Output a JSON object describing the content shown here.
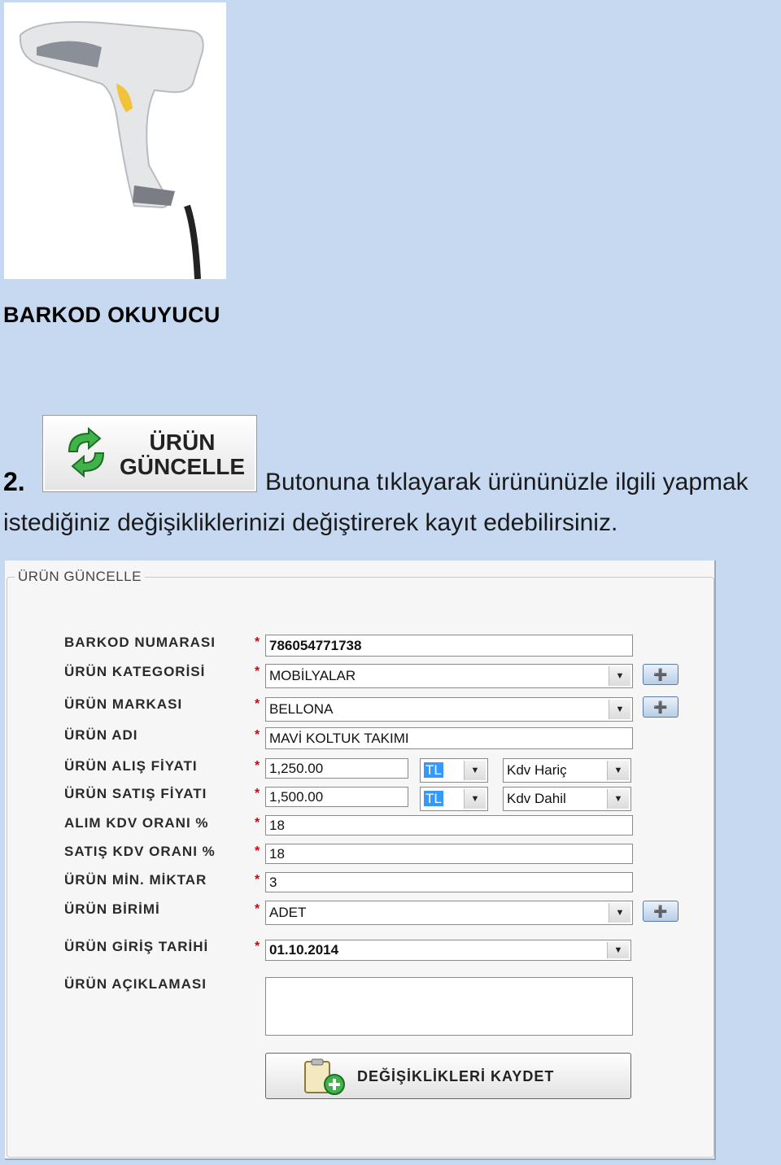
{
  "caption": "BARKOD OKUYUCU",
  "step_number": "2.",
  "button_image": {
    "line1": "ÜRÜN",
    "line2": "GÜNCELLE"
  },
  "paragraph": {
    "line1": "Butonuna tıklayarak ürününüzle ilgili yapmak",
    "line2": "istediğiniz değişikliklerinizi değiştirerek kayıt edebilirsiniz."
  },
  "form": {
    "title": "ÜRÜN GÜNCELLE",
    "required_mark": "*",
    "barcode": {
      "label": "BARKOD NUMARASI",
      "value": "786054771738"
    },
    "category": {
      "label": "ÜRÜN KATEGORİSİ",
      "value": "MOBİLYALAR"
    },
    "brand": {
      "label": "ÜRÜN MARKASI",
      "value": "BELLONA"
    },
    "name": {
      "label": "ÜRÜN ADI",
      "value": "MAVİ KOLTUK TAKIMI"
    },
    "buy_price": {
      "label": "ÜRÜN ALIŞ FİYATI",
      "value": "1,250.00",
      "currency": "TL",
      "vat_mode": "Kdv Hariç"
    },
    "sell_price": {
      "label": "ÜRÜN SATIŞ FİYATI",
      "value": "1,500.00",
      "currency": "TL",
      "vat_mode": "Kdv Dahil"
    },
    "buy_vat": {
      "label": "ALIM KDV ORANI %",
      "value": "18"
    },
    "sell_vat": {
      "label": "SATIŞ KDV ORANI %",
      "value": "18"
    },
    "min_qty": {
      "label": "ÜRÜN MİN. MİKTAR",
      "value": "3"
    },
    "unit": {
      "label": "ÜRÜN BİRİMİ",
      "value": "ADET"
    },
    "entry_date": {
      "label": "ÜRÜN GİRİŞ TARİHİ",
      "value": "01.10.2014"
    },
    "description": {
      "label": "ÜRÜN AÇIKLAMASI",
      "value": ""
    },
    "save_label": "DEĞİŞİKLİKLERİ KAYDET"
  },
  "icons": {
    "refresh": "refresh-arrows-icon",
    "add": "add-folder-icon",
    "save": "clipboard-add-icon",
    "dropdown": "chevron-down-icon"
  }
}
